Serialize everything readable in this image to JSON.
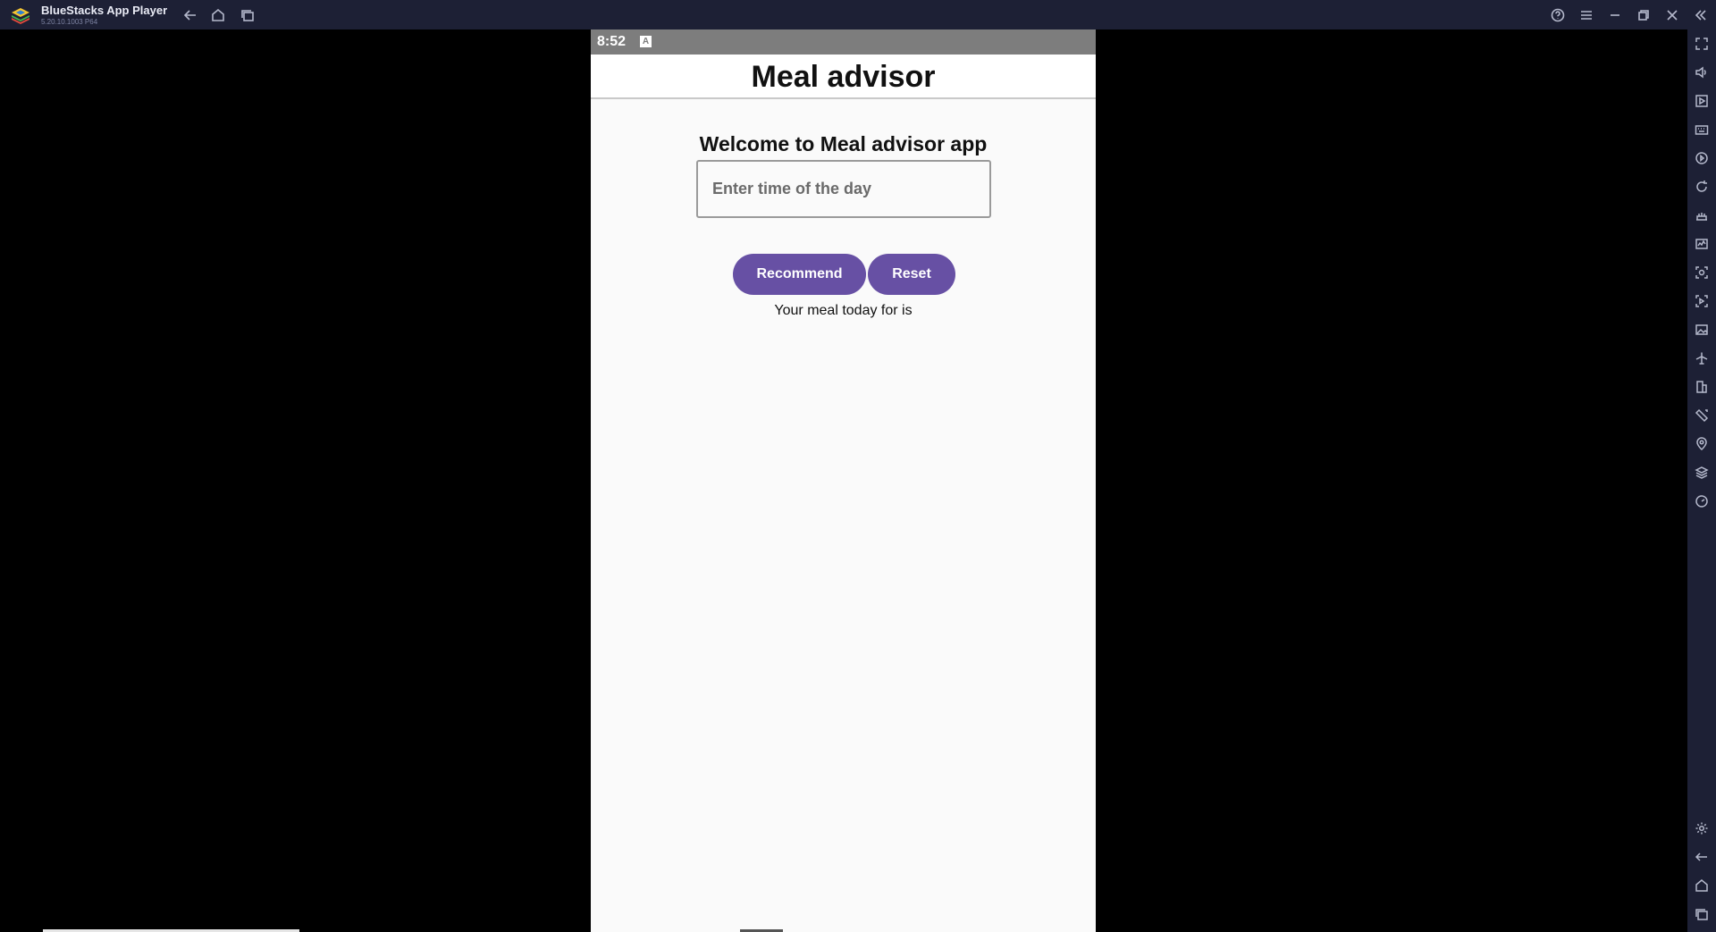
{
  "window": {
    "app_name": "BlueStacks App Player",
    "version": "5.20.10.1003 P64"
  },
  "titlebar_icons": [
    "back-arrow-icon",
    "home-icon",
    "recent-apps-icon",
    "help-icon",
    "menu-icon",
    "minimize-icon",
    "restore-icon",
    "close-icon",
    "collapse-sidebar-icon"
  ],
  "sidebar_icons": [
    "fullscreen-icon",
    "volume-icon",
    "media-icon",
    "keyboard-icon",
    "macro-icon",
    "sync-icon",
    "game-controls-icon",
    "performance-icon",
    "screenshot-icon",
    "record-icon",
    "gallery-icon",
    "airplane-icon",
    "multi-instance-icon",
    "rotate-icon",
    "location-icon",
    "layers-icon",
    "eco-mode-icon",
    "settings-icon",
    "back-icon",
    "home-icon",
    "recent-apps-icon"
  ],
  "statusbar": {
    "time": "8:52",
    "indicator": "A"
  },
  "app": {
    "title": "Meal advisor",
    "welcome": "Welcome to Meal advisor app",
    "input_placeholder": "Enter time of the day",
    "recommend_label": "Recommend",
    "reset_label": "Reset",
    "result_text": "Your meal today for  is"
  },
  "colors": {
    "accent": "#6750a4",
    "chrome": "#1d2035",
    "statusbar": "#7d7d7d"
  }
}
